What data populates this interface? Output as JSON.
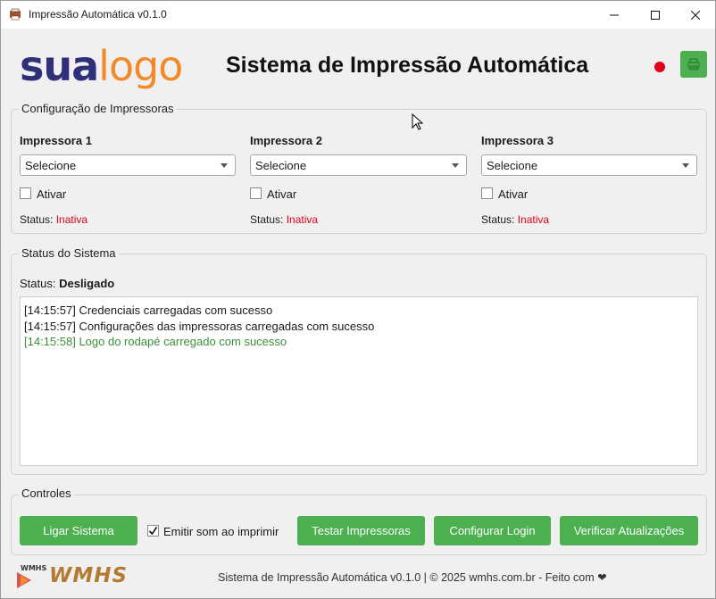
{
  "window": {
    "title": "Impressão Automática v0.1.0"
  },
  "header": {
    "logo_part1": "sua",
    "logo_part2": "logo",
    "title": "Sistema de Impressão Automática",
    "status_color": "#e3001b"
  },
  "printers_group": {
    "title": "Configuração de Impressoras",
    "printers": [
      {
        "name": "Impressora 1",
        "selected": "Selecione",
        "activate_label": "Ativar",
        "activated": false,
        "status_label": "Status:",
        "status_value": "Inativa"
      },
      {
        "name": "Impressora 2",
        "selected": "Selecione",
        "activate_label": "Ativar",
        "activated": false,
        "status_label": "Status:",
        "status_value": "Inativa"
      },
      {
        "name": "Impressora 3",
        "selected": "Selecione",
        "activate_label": "Ativar",
        "activated": false,
        "status_label": "Status:",
        "status_value": "Inativa"
      }
    ]
  },
  "system_group": {
    "title": "Status do Sistema",
    "status_label": "Status:",
    "status_value": "Desligado",
    "log": [
      {
        "text": "[14:15:57] Credenciais carregadas com sucesso",
        "level": "info"
      },
      {
        "text": "[14:15:57] Configurações das impressoras carregadas com sucesso",
        "level": "info"
      },
      {
        "text": "[14:15:58] Logo do rodapé carregado com sucesso",
        "level": "success"
      }
    ]
  },
  "controls_group": {
    "title": "Controles",
    "start_button": "Ligar Sistema",
    "sound_checkbox_label": "Emitir som ao imprimir",
    "sound_checked": true,
    "test_button": "Testar Impressoras",
    "login_button": "Configurar Login",
    "update_button": "Verificar Atualizações"
  },
  "footer": {
    "brand_logo_text": "WMHS",
    "text": "Sistema de Impressão Automática v0.1.0 | © 2025 wmhs.com.br - Feito com ❤"
  },
  "colors": {
    "accent_green": "#4caf50",
    "error_red": "#e3001b",
    "success_green": "#3a8f3a",
    "logo_blue": "#30307a",
    "logo_orange": "#f28a2a"
  }
}
